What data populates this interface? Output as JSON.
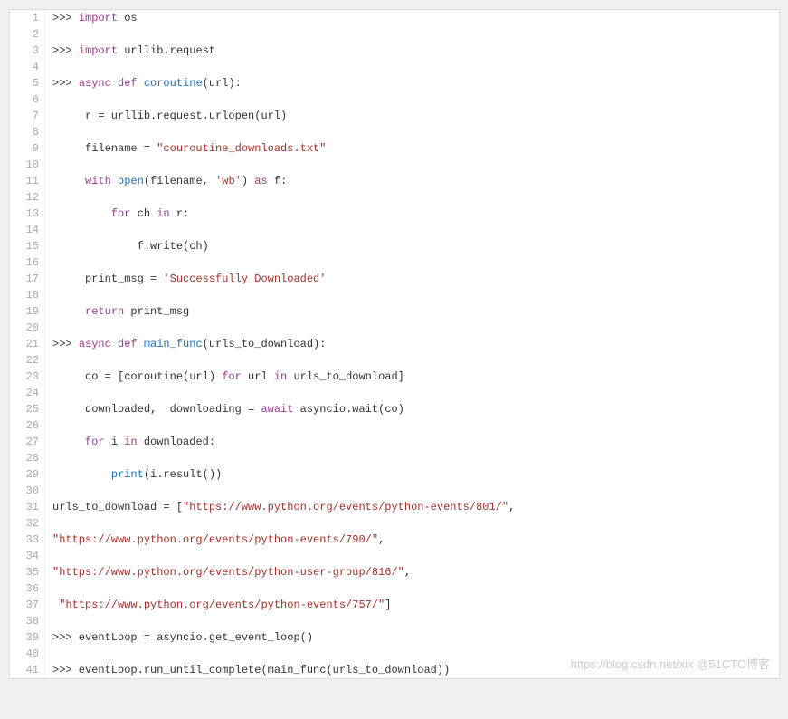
{
  "lines": [
    {
      "n": 1,
      "t": [
        {
          "c": "n",
          "x": ">>> "
        },
        {
          "c": "p",
          "x": "import"
        },
        {
          "c": "n",
          "x": " os"
        }
      ]
    },
    {
      "n": 2,
      "t": []
    },
    {
      "n": 3,
      "t": [
        {
          "c": "n",
          "x": ">>> "
        },
        {
          "c": "p",
          "x": "import"
        },
        {
          "c": "n",
          "x": " urllib.request"
        }
      ]
    },
    {
      "n": 4,
      "t": []
    },
    {
      "n": 5,
      "t": [
        {
          "c": "n",
          "x": ">>> "
        },
        {
          "c": "p",
          "x": "async def"
        },
        {
          "c": "n",
          "x": " "
        },
        {
          "c": "b",
          "x": "coroutine"
        },
        {
          "c": "n",
          "x": "(url):"
        }
      ]
    },
    {
      "n": 6,
      "t": []
    },
    {
      "n": 7,
      "t": [
        {
          "c": "n",
          "x": "     r = urllib.request.urlopen(url)"
        }
      ]
    },
    {
      "n": 8,
      "t": []
    },
    {
      "n": 9,
      "t": [
        {
          "c": "n",
          "x": "     filename = "
        },
        {
          "c": "s",
          "x": "\"couroutine_downloads.txt\""
        }
      ]
    },
    {
      "n": 10,
      "t": []
    },
    {
      "n": 11,
      "t": [
        {
          "c": "n",
          "x": "     "
        },
        {
          "c": "p",
          "x": "with"
        },
        {
          "c": "n",
          "x": " "
        },
        {
          "c": "b",
          "x": "open"
        },
        {
          "c": "n",
          "x": "(filename, "
        },
        {
          "c": "s",
          "x": "'wb'"
        },
        {
          "c": "n",
          "x": ") "
        },
        {
          "c": "p",
          "x": "as"
        },
        {
          "c": "n",
          "x": " f:"
        }
      ]
    },
    {
      "n": 12,
      "t": []
    },
    {
      "n": 13,
      "t": [
        {
          "c": "n",
          "x": "         "
        },
        {
          "c": "p",
          "x": "for"
        },
        {
          "c": "n",
          "x": " ch "
        },
        {
          "c": "p",
          "x": "in"
        },
        {
          "c": "n",
          "x": " r:"
        }
      ]
    },
    {
      "n": 14,
      "t": []
    },
    {
      "n": 15,
      "t": [
        {
          "c": "n",
          "x": "             f.write(ch)"
        }
      ]
    },
    {
      "n": 16,
      "t": []
    },
    {
      "n": 17,
      "t": [
        {
          "c": "n",
          "x": "     print_msg = "
        },
        {
          "c": "s",
          "x": "'Successfully Downloaded'"
        }
      ]
    },
    {
      "n": 18,
      "t": []
    },
    {
      "n": 19,
      "t": [
        {
          "c": "n",
          "x": "     "
        },
        {
          "c": "p",
          "x": "return"
        },
        {
          "c": "n",
          "x": " print_msg"
        }
      ]
    },
    {
      "n": 20,
      "t": []
    },
    {
      "n": 21,
      "t": [
        {
          "c": "n",
          "x": ">>> "
        },
        {
          "c": "p",
          "x": "async def"
        },
        {
          "c": "n",
          "x": " "
        },
        {
          "c": "b",
          "x": "main_func"
        },
        {
          "c": "n",
          "x": "(urls_to_download):"
        }
      ]
    },
    {
      "n": 22,
      "t": []
    },
    {
      "n": 23,
      "t": [
        {
          "c": "n",
          "x": "     co = [coroutine(url) "
        },
        {
          "c": "p",
          "x": "for"
        },
        {
          "c": "n",
          "x": " url "
        },
        {
          "c": "p",
          "x": "in"
        },
        {
          "c": "n",
          "x": " urls_to_download]"
        }
      ]
    },
    {
      "n": 24,
      "t": []
    },
    {
      "n": 25,
      "t": [
        {
          "c": "n",
          "x": "     downloaded,  downloading = "
        },
        {
          "c": "p",
          "x": "await"
        },
        {
          "c": "n",
          "x": " asyncio.wait(co)"
        }
      ]
    },
    {
      "n": 26,
      "t": []
    },
    {
      "n": 27,
      "t": [
        {
          "c": "n",
          "x": "     "
        },
        {
          "c": "p",
          "x": "for"
        },
        {
          "c": "n",
          "x": " i "
        },
        {
          "c": "p",
          "x": "in"
        },
        {
          "c": "n",
          "x": " downloaded:"
        }
      ]
    },
    {
      "n": 28,
      "t": []
    },
    {
      "n": 29,
      "t": [
        {
          "c": "n",
          "x": "         "
        },
        {
          "c": "b",
          "x": "print"
        },
        {
          "c": "n",
          "x": "(i.result())"
        }
      ]
    },
    {
      "n": 30,
      "t": []
    },
    {
      "n": 31,
      "t": [
        {
          "c": "n",
          "x": "urls_to_download = ["
        },
        {
          "c": "s",
          "x": "\"https://www.python.org/events/python-events/801/\""
        },
        {
          "c": "n",
          "x": ","
        }
      ]
    },
    {
      "n": 32,
      "t": []
    },
    {
      "n": 33,
      "t": [
        {
          "c": "s",
          "x": "\"https://www.python.org/events/python-events/790/\""
        },
        {
          "c": "n",
          "x": ","
        }
      ]
    },
    {
      "n": 34,
      "t": []
    },
    {
      "n": 35,
      "t": [
        {
          "c": "s",
          "x": "\"https://www.python.org/events/python-user-group/816/\""
        },
        {
          "c": "n",
          "x": ","
        }
      ]
    },
    {
      "n": 36,
      "t": []
    },
    {
      "n": 37,
      "t": [
        {
          "c": "n",
          "x": " "
        },
        {
          "c": "s",
          "x": "\"https://www.python.org/events/python-events/757/\""
        },
        {
          "c": "n",
          "x": "]"
        }
      ]
    },
    {
      "n": 38,
      "t": []
    },
    {
      "n": 39,
      "t": [
        {
          "c": "n",
          "x": ">>> eventLoop = asyncio.get_event_loop()"
        }
      ]
    },
    {
      "n": 40,
      "t": []
    },
    {
      "n": 41,
      "t": [
        {
          "c": "n",
          "x": ">>> eventLoop.run_until_complete(main_func(urls_to_download))"
        }
      ]
    }
  ],
  "watermark": "https://blog.csdn.net/xix  @51CTO博客"
}
